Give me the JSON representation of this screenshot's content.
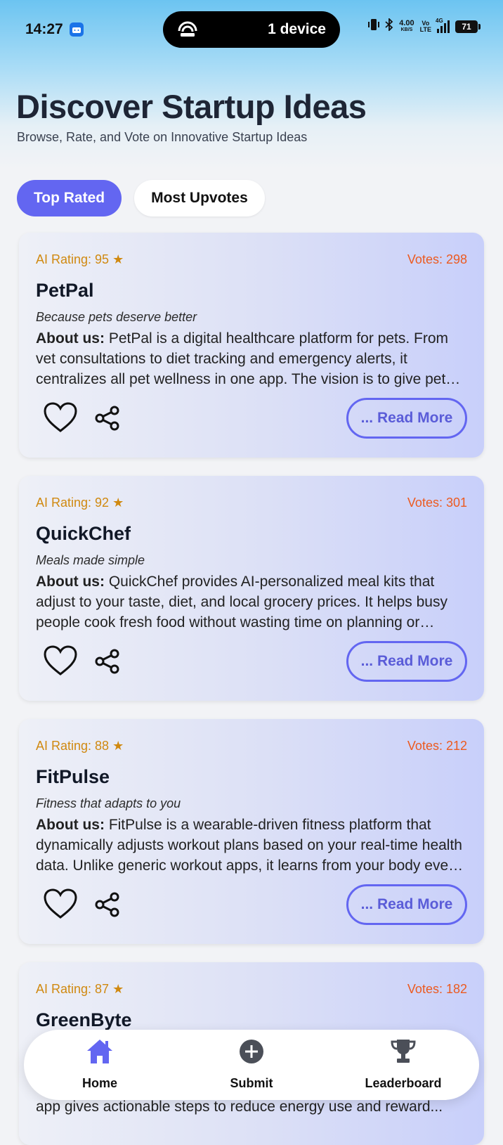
{
  "status_bar": {
    "time": "14:27",
    "pill_text": "1 device",
    "speed_value": "4.00",
    "speed_unit": "KB/S",
    "volte_top": "Vo",
    "volte_bottom": "LTE",
    "network": "4G",
    "battery": "71"
  },
  "header": {
    "title": "Discover Startup Ideas",
    "subtitle": "Browse, Rate, and Vote on Innovative Startup Ideas"
  },
  "tabs": [
    {
      "label": "Top Rated",
      "active": true
    },
    {
      "label": "Most Upvotes",
      "active": false
    }
  ],
  "cards": [
    {
      "rating": "AI Rating: 95 ★",
      "votes": "Votes: 298",
      "name": "PetPal",
      "tagline": "Because pets deserve better",
      "about_label": "About us:",
      "about": " PetPal is a digital healthcare platform for pets. From vet consultations to diet tracking and emergency alerts, it centralizes all pet wellness in one app. The vision is to give pet owners peace of mind.",
      "read_more": "... Read More"
    },
    {
      "rating": "AI Rating: 92 ★",
      "votes": "Votes: 301",
      "name": "QuickChef",
      "tagline": "Meals made simple",
      "about_label": "About us:",
      "about": " QuickChef provides AI-personalized meal kits that adjust to your taste, diet, and local grocery prices. It helps busy people cook fresh food without wasting time on planning or shopping.",
      "read_more": "... Read More"
    },
    {
      "rating": "AI Rating: 88 ★",
      "votes": "Votes: 212",
      "name": "FitPulse",
      "tagline": "Fitness that adapts to you",
      "about_label": "About us:",
      "about": " FitPulse is a wearable-driven fitness platform that dynamically adjusts workout plans based on your real-time health data. Unlike generic workout apps, it learns from your body every day.",
      "read_more": "... Read More"
    },
    {
      "rating": "AI Rating: 87 ★",
      "votes": "Votes: 182",
      "name": "GreenByte",
      "tagline": "",
      "about_label": "",
      "about": "app gives actionable steps to reduce energy use and reward...",
      "read_more": ""
    }
  ],
  "bottom_nav": [
    {
      "label": "Home",
      "icon": "home-icon"
    },
    {
      "label": "Submit",
      "icon": "plus-circle-icon"
    },
    {
      "label": "Leaderboard",
      "icon": "trophy-icon"
    }
  ],
  "colors": {
    "accent": "#6366f1",
    "rating": "#d08910",
    "votes": "#ec5a20",
    "title": "#1e2535"
  }
}
